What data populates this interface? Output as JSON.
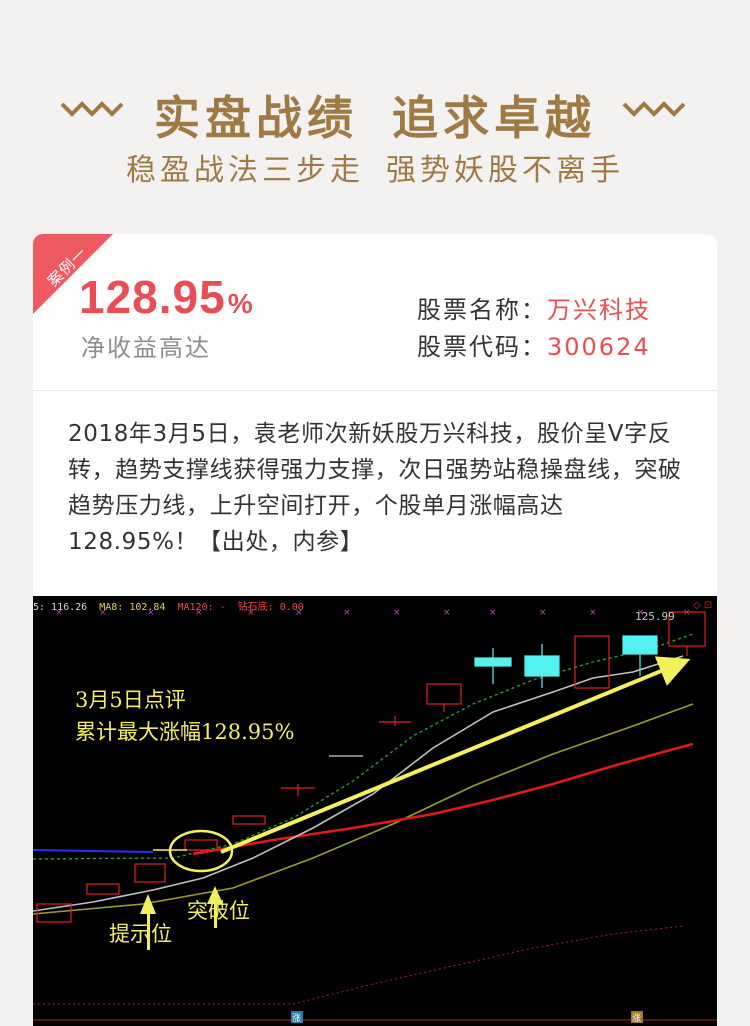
{
  "header": {
    "title_left": "实盘战绩",
    "title_right": "追求卓越",
    "subtitle_left": "稳盈战法三步走",
    "subtitle_right": "强势妖股不离手",
    "accent_color": "#a07a45"
  },
  "case": {
    "ribbon": "案例一",
    "return_value": "128.95",
    "return_unit": "%",
    "return_label": "净收益高达",
    "stock_name_label": "股票名称：",
    "stock_name": "万兴科技",
    "stock_code_label": "股票代码：",
    "stock_code": "300624",
    "highlight_color": "#e94e55",
    "description": "2018年3月5日，袁老师次新妖股万兴科技，股价呈V字反转，趋势支撑线获得强力支撑，次日强势站稳操盘线，突破趋势压力线，上升空间打开，个股单月涨幅高达128.95%！【出处，内参】"
  },
  "chart": {
    "legend": [
      {
        "text": "5: 116.26",
        "color": "#d9d9d9"
      },
      {
        "text": "MA8: 102.84",
        "color": "#e8d24a"
      },
      {
        "text": "MA120: -",
        "color": "#ff4040"
      },
      {
        "text": "钻石底: 0.00",
        "color": "#ff4040"
      }
    ],
    "annotation_line1": "3月5日点评",
    "annotation_line2": "累计最大涨幅128.95%",
    "price_label": "125.99",
    "label_tip": "提示位",
    "label_break": "突破位",
    "marker_left": "涨",
    "marker_right": "涨"
  }
}
